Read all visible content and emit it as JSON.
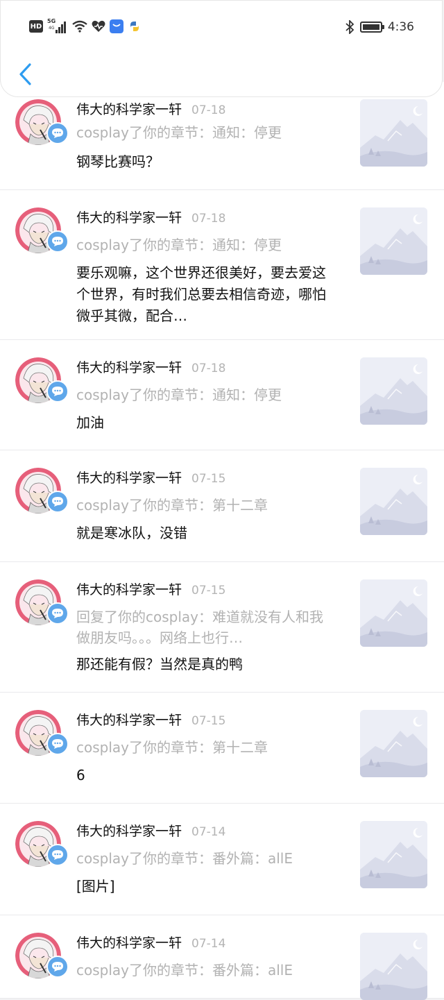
{
  "status_bar": {
    "hd": "HD",
    "network": "5G",
    "network_sub": "4G",
    "time": "4:36"
  },
  "icons": {
    "back": "chevron-left-icon",
    "comment_badge": "message-bubble-icon",
    "wifi": "wifi-icon",
    "bluetooth": "bluetooth-icon",
    "battery": "battery-icon"
  },
  "colors": {
    "accent": "#2d9cf0",
    "badge": "#5fa7ea",
    "muted_text": "#b2b2b2"
  },
  "notifications": [
    {
      "user": "伟大的科学家一轩",
      "date": "07-18",
      "context": "cosplay了你的章节：通知：停更",
      "message": "钢琴比赛吗？"
    },
    {
      "user": "伟大的科学家一轩",
      "date": "07-18",
      "context": "cosplay了你的章节：通知：停更",
      "message": "要乐观嘛，这个世界还很美好，要去爱这个世界，有时我们总要去相信奇迹，哪怕微乎其微，配合…"
    },
    {
      "user": "伟大的科学家一轩",
      "date": "07-18",
      "context": "cosplay了你的章节：通知：停更",
      "message": "加油"
    },
    {
      "user": "伟大的科学家一轩",
      "date": "07-15",
      "context": "cosplay了你的章节：第十二章",
      "message": "就是寒冰队，没错"
    },
    {
      "user": "伟大的科学家一轩",
      "date": "07-15",
      "context": "回复了你的cosplay：难道就没有人和我做朋友吗。。。网络上也行…",
      "message": "那还能有假？当然是真的鸭"
    },
    {
      "user": "伟大的科学家一轩",
      "date": "07-15",
      "context": "cosplay了你的章节：第十二章",
      "message": "6"
    },
    {
      "user": "伟大的科学家一轩",
      "date": "07-14",
      "context": "cosplay了你的章节：番外篇：allE",
      "message": "[图片]"
    },
    {
      "user": "伟大的科学家一轩",
      "date": "07-14",
      "context": "cosplay了你的章节：番外篇：allE",
      "message": ""
    }
  ]
}
